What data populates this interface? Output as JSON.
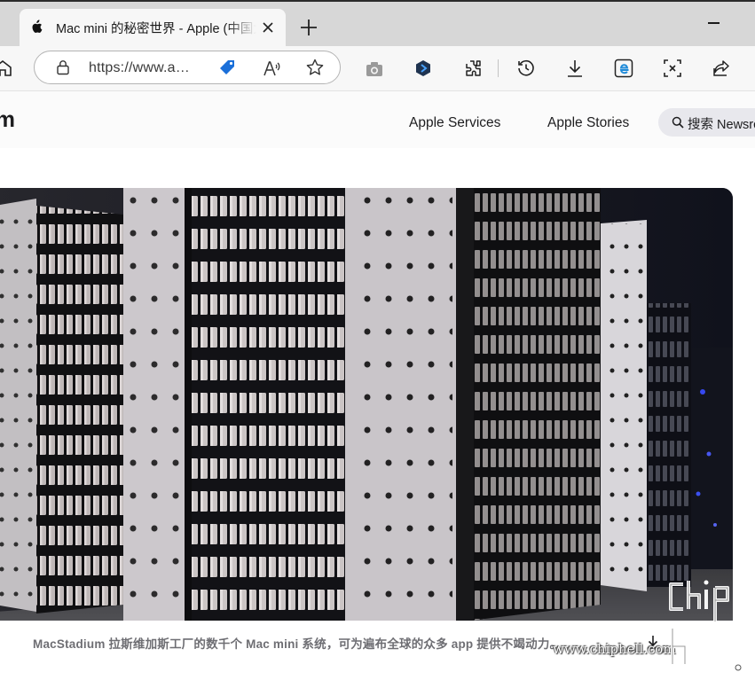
{
  "browser": {
    "tab": {
      "title": "Mac mini 的秘密世界 - Apple (中国大陆)",
      "favicon": "apple-logo-icon",
      "close": "close-icon"
    },
    "new_tab": "plus-icon",
    "address_bar": {
      "url": "https://www.apple.com.cn/newsroom/",
      "lock": "lock-icon"
    },
    "toolbar_icons": [
      "home-icon",
      "tag-icon",
      "read-aloud-icon",
      "favorite-star-icon",
      "screenshot-camera-icon",
      "extension-hexagon-icon",
      "extensions-puzzle-icon",
      "history-icon",
      "downloads-icon",
      "ie-mode-icon",
      "web-capture-icon",
      "share-icon"
    ]
  },
  "site": {
    "brand": "Newsroom",
    "nav": {
      "services": "Apple Services",
      "stories": "Apple Stories",
      "search_label": "搜索 Newsroom"
    }
  },
  "hero": {
    "caption": "MacStadium 拉斯维加斯工厂的数千个 Mac mini 系统，可为遍布全球的众多 app 提供不竭动力。",
    "download": "download-icon"
  },
  "watermark": {
    "site": "www.chiphell.com",
    "logo_text": "chip hell"
  }
}
